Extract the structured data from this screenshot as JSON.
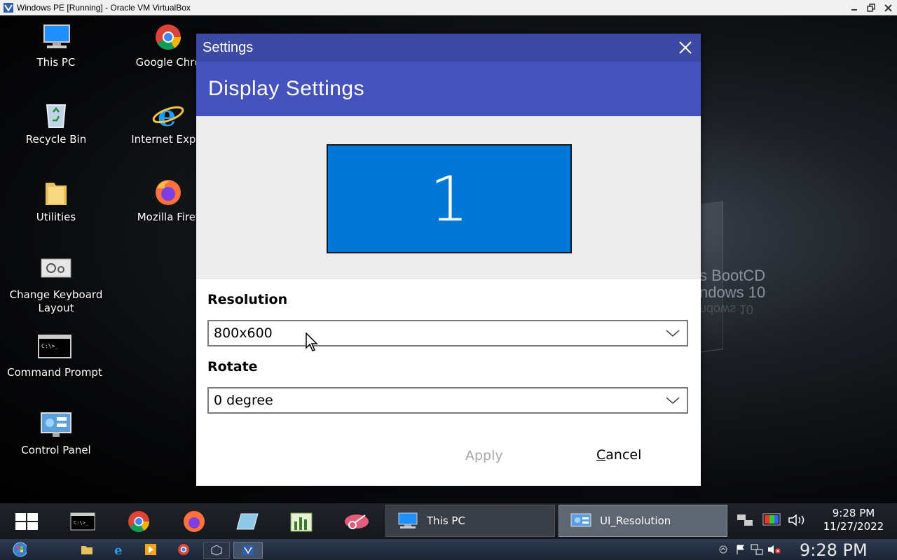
{
  "host": {
    "window_title": "Windows PE [Running] - Oracle VM VirtualBox",
    "controls": [
      "minimize",
      "restore",
      "close"
    ],
    "bottom_clock": "9:28 PM"
  },
  "desktop": {
    "icons": [
      {
        "label": "This PC",
        "icon": "this-pc-icon"
      },
      {
        "label": "Google Chro",
        "icon": "chrome-icon"
      },
      {
        "label": "Recycle Bin",
        "icon": "recycle-bin-icon"
      },
      {
        "label": "Internet Explo",
        "icon": "internet-explorer-icon"
      },
      {
        "label": "Utilities",
        "icon": "folder-icon"
      },
      {
        "label": "Mozilla Firef",
        "icon": "firefox-icon"
      },
      {
        "label": "Change Keyboard Layout",
        "icon": "keyboard-settings-icon"
      },
      {
        "label": "Command Prompt",
        "icon": "command-prompt-icon"
      },
      {
        "label": "Control Panel",
        "icon": "control-panel-icon"
      }
    ],
    "wallpaper_text_line1": "s BootCD",
    "wallpaper_text_line2": "ndows 10",
    "wallpaper_text_reflection": "ndows 10"
  },
  "dialog": {
    "title": "Settings",
    "header": "Display Settings",
    "monitor_number": "1",
    "resolution_label": "Resolution",
    "resolution_value": "800x600",
    "rotate_label": "Rotate",
    "rotate_value": "0 degree",
    "apply_label": "Apply",
    "cancel_label": "ancel",
    "cancel_mnemonic": "C"
  },
  "taskbar": {
    "tasks": [
      {
        "label": "This PC",
        "icon": "this-pc-icon",
        "active": false
      },
      {
        "label": "UI_Resolution",
        "icon": "display-settings-icon",
        "active": true
      }
    ],
    "clock_time": "9:28 PM",
    "clock_date": "11/27/2022"
  },
  "colors": {
    "dialog_titlebar": "#3c4aa6",
    "dialog_header": "#4551bd",
    "monitor_fill": "#0078d7",
    "apply_disabled": "#a8a8a8"
  }
}
